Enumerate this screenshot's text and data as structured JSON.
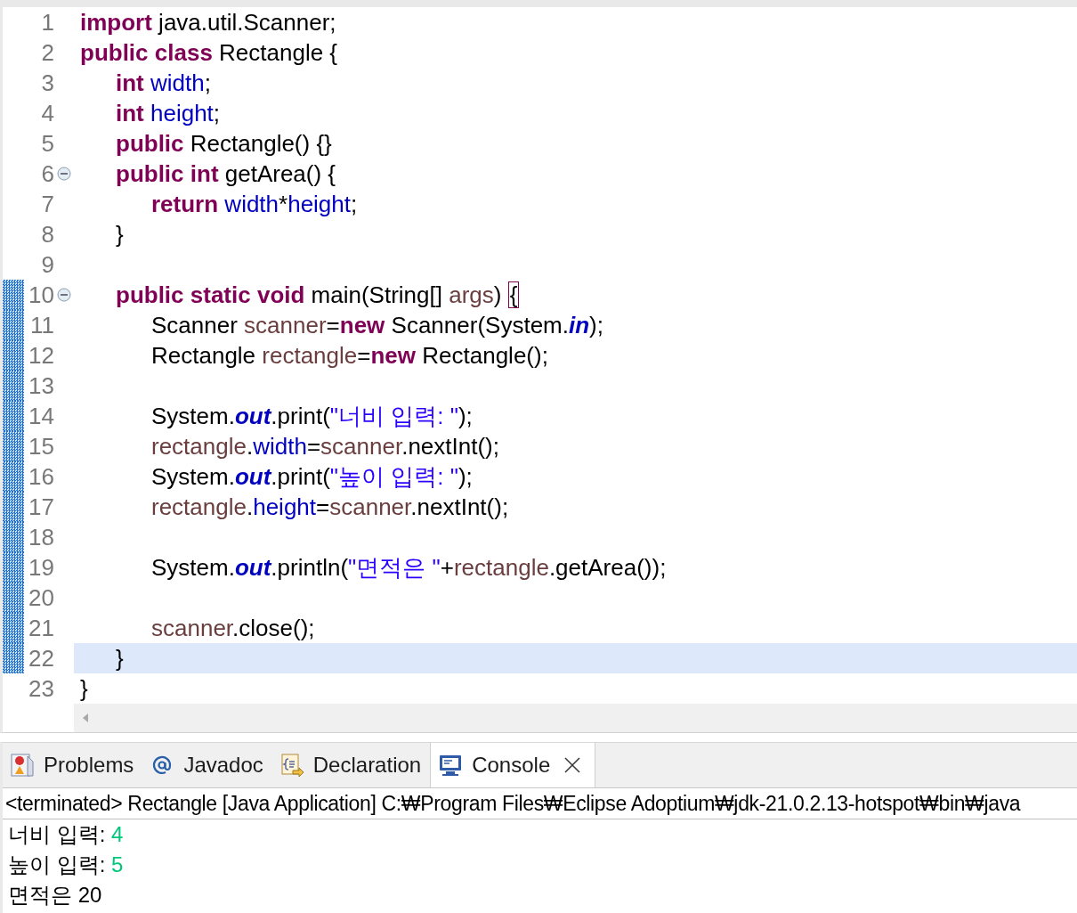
{
  "editor": {
    "lines": [
      {
        "number": "1",
        "changed": false,
        "current": false,
        "folding": false,
        "tokens": [
          {
            "kind": "keyword",
            "text": "import"
          },
          {
            "kind": "plain",
            "text": " java.util.Scanner;"
          }
        ]
      },
      {
        "number": "2",
        "changed": false,
        "current": false,
        "folding": false,
        "tokens": [
          {
            "kind": "keyword",
            "text": "public class"
          },
          {
            "kind": "plain",
            "text": " Rectangle {"
          }
        ]
      },
      {
        "number": "3",
        "changed": false,
        "current": false,
        "folding": false,
        "tokens": [
          {
            "kind": "keyword",
            "text": "\tint"
          },
          {
            "kind": "field",
            "text": " width"
          },
          {
            "kind": "plain",
            "text": ";"
          }
        ]
      },
      {
        "number": "4",
        "changed": false,
        "current": false,
        "folding": false,
        "tokens": [
          {
            "kind": "keyword",
            "text": "\tint"
          },
          {
            "kind": "field",
            "text": " height"
          },
          {
            "kind": "plain",
            "text": ";"
          }
        ]
      },
      {
        "number": "5",
        "changed": false,
        "current": false,
        "folding": false,
        "tokens": [
          {
            "kind": "keyword",
            "text": "\tpublic"
          },
          {
            "kind": "plain",
            "text": " Rectangle() {}"
          }
        ]
      },
      {
        "number": "6",
        "changed": false,
        "current": false,
        "folding": true,
        "tokens": [
          {
            "kind": "keyword",
            "text": "\tpublic int"
          },
          {
            "kind": "plain",
            "text": " getArea() {"
          }
        ]
      },
      {
        "number": "7",
        "changed": false,
        "current": false,
        "folding": false,
        "tokens": [
          {
            "kind": "keyword",
            "text": "\t\treturn"
          },
          {
            "kind": "field",
            "text": " width"
          },
          {
            "kind": "plain",
            "text": "*"
          },
          {
            "kind": "field",
            "text": "height"
          },
          {
            "kind": "plain",
            "text": ";"
          }
        ]
      },
      {
        "number": "8",
        "changed": false,
        "current": false,
        "folding": false,
        "tokens": [
          {
            "kind": "plain",
            "text": "\t}"
          }
        ]
      },
      {
        "number": "9",
        "changed": false,
        "current": false,
        "folding": false
      },
      {
        "number": "10",
        "changed": true,
        "current": false,
        "folding": true,
        "tokens": [
          {
            "kind": "keyword",
            "text": "\tpublic static void"
          },
          {
            "kind": "plain",
            "text": " main(String[] "
          },
          {
            "kind": "local",
            "text": "args"
          },
          {
            "kind": "plain",
            "text": ") "
          },
          {
            "kind": "bracket",
            "text": "{"
          }
        ]
      },
      {
        "number": "11",
        "changed": true,
        "current": false,
        "folding": false,
        "tokens": [
          {
            "kind": "plain",
            "text": "\t\tScanner "
          },
          {
            "kind": "local",
            "text": "scanner"
          },
          {
            "kind": "plain",
            "text": "="
          },
          {
            "kind": "keyword",
            "text": "new"
          },
          {
            "kind": "plain",
            "text": " Scanner(System."
          },
          {
            "kind": "static",
            "text": "in"
          },
          {
            "kind": "plain",
            "text": ");"
          }
        ]
      },
      {
        "number": "12",
        "changed": true,
        "current": false,
        "folding": false,
        "tokens": [
          {
            "kind": "plain",
            "text": "\t\tRectangle "
          },
          {
            "kind": "local",
            "text": "rectangle"
          },
          {
            "kind": "plain",
            "text": "="
          },
          {
            "kind": "keyword",
            "text": "new"
          },
          {
            "kind": "plain",
            "text": " Rectangle();"
          }
        ]
      },
      {
        "number": "13",
        "changed": true,
        "current": false,
        "folding": false
      },
      {
        "number": "14",
        "changed": true,
        "current": false,
        "folding": false,
        "tokens": [
          {
            "kind": "plain",
            "text": "\t\tSystem."
          },
          {
            "kind": "static",
            "text": "out"
          },
          {
            "kind": "plain",
            "text": ".print("
          },
          {
            "kind": "string",
            "text": "\"너비 입력: \""
          },
          {
            "kind": "plain",
            "text": ");"
          }
        ]
      },
      {
        "number": "15",
        "changed": true,
        "current": false,
        "folding": false,
        "tokens": [
          {
            "kind": "local",
            "text": "\t\trectangle"
          },
          {
            "kind": "plain",
            "text": "."
          },
          {
            "kind": "field",
            "text": "width"
          },
          {
            "kind": "plain",
            "text": "="
          },
          {
            "kind": "local",
            "text": "scanner"
          },
          {
            "kind": "plain",
            "text": ".nextInt();"
          }
        ]
      },
      {
        "number": "16",
        "changed": true,
        "current": false,
        "folding": false,
        "tokens": [
          {
            "kind": "plain",
            "text": "\t\tSystem."
          },
          {
            "kind": "static",
            "text": "out"
          },
          {
            "kind": "plain",
            "text": ".print("
          },
          {
            "kind": "string",
            "text": "\"높이 입력: \""
          },
          {
            "kind": "plain",
            "text": ");"
          }
        ]
      },
      {
        "number": "17",
        "changed": true,
        "current": false,
        "folding": false,
        "tokens": [
          {
            "kind": "local",
            "text": "\t\trectangle"
          },
          {
            "kind": "plain",
            "text": "."
          },
          {
            "kind": "field",
            "text": "height"
          },
          {
            "kind": "plain",
            "text": "="
          },
          {
            "kind": "local",
            "text": "scanner"
          },
          {
            "kind": "plain",
            "text": ".nextInt();"
          }
        ]
      },
      {
        "number": "18",
        "changed": true,
        "current": false,
        "folding": false
      },
      {
        "number": "19",
        "changed": true,
        "current": false,
        "folding": false,
        "tokens": [
          {
            "kind": "plain",
            "text": "\t\tSystem."
          },
          {
            "kind": "static",
            "text": "out"
          },
          {
            "kind": "plain",
            "text": ".println("
          },
          {
            "kind": "string",
            "text": "\"면적은 \""
          },
          {
            "kind": "plain",
            "text": "+"
          },
          {
            "kind": "local",
            "text": "rectangle"
          },
          {
            "kind": "plain",
            "text": ".getArea());"
          }
        ]
      },
      {
        "number": "20",
        "changed": true,
        "current": false,
        "folding": false
      },
      {
        "number": "21",
        "changed": true,
        "current": false,
        "folding": false,
        "tokens": [
          {
            "kind": "local",
            "text": "\t\tscanner"
          },
          {
            "kind": "plain",
            "text": ".close();"
          }
        ]
      },
      {
        "number": "22",
        "changed": true,
        "current": true,
        "folding": false,
        "tokens": [
          {
            "kind": "plain",
            "text": "\t}"
          }
        ]
      },
      {
        "number": "23",
        "changed": false,
        "current": false,
        "folding": false,
        "tokens": [
          {
            "kind": "plain",
            "text": "}"
          }
        ]
      }
    ]
  },
  "panel": {
    "tabs": [
      {
        "kind": "problems",
        "label": "Problems",
        "selected": false
      },
      {
        "kind": "javadoc",
        "label": "Javadoc",
        "selected": false
      },
      {
        "kind": "declaration",
        "label": "Declaration",
        "selected": false
      },
      {
        "kind": "console",
        "label": "Console",
        "selected": true
      }
    ],
    "console": {
      "header": "<terminated> Rectangle [Java Application] C:₩Program Files₩Eclipse Adoptium₩jdk-21.0.2.13-hotspot₩bin₩java",
      "lines": [
        [
          {
            "kind": "output",
            "text": "너비 입력: "
          },
          {
            "kind": "input",
            "text": "4"
          }
        ],
        [
          {
            "kind": "output",
            "text": "높이 입력: "
          },
          {
            "kind": "input",
            "text": "5"
          }
        ],
        [
          {
            "kind": "output",
            "text": "면적은 20"
          }
        ]
      ]
    }
  }
}
